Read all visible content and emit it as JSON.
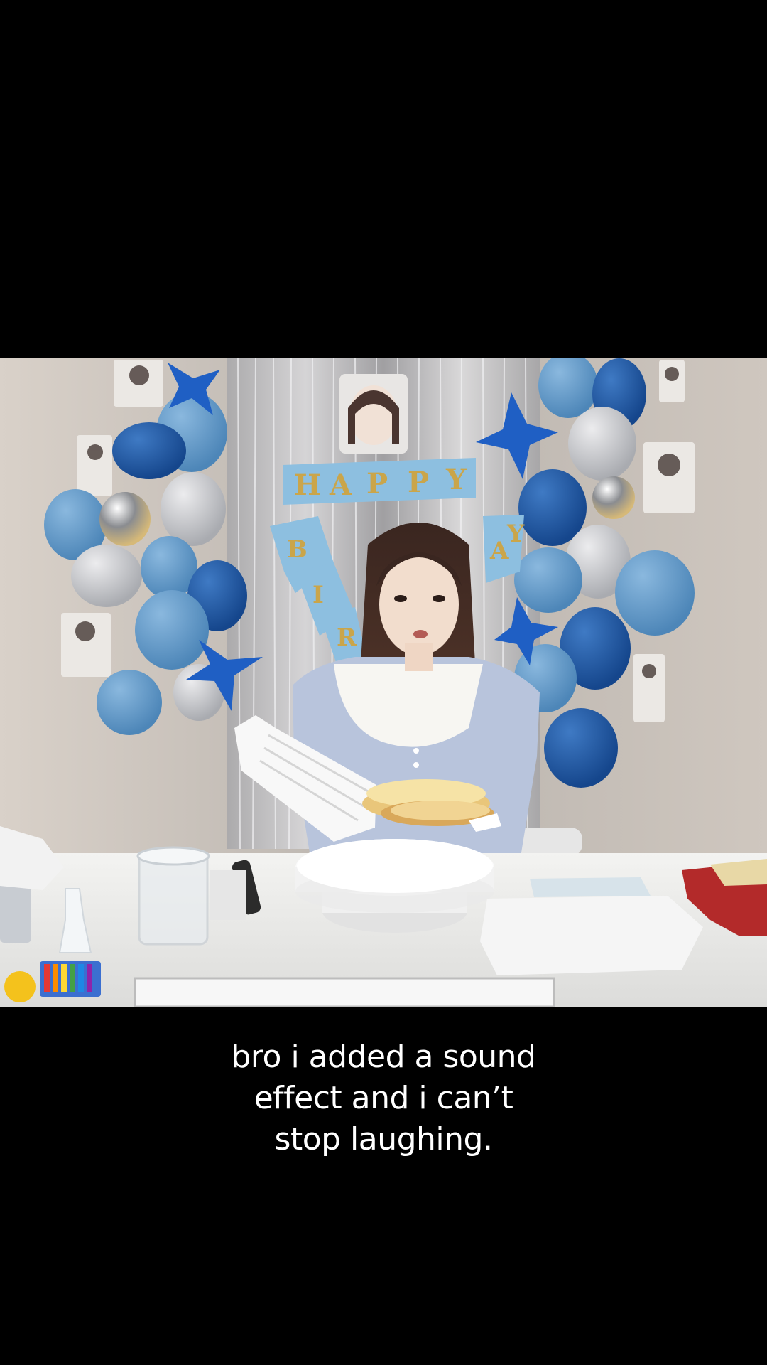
{
  "video": {
    "banner_top_letters": [
      "H",
      "A",
      "P",
      "P",
      "Y"
    ],
    "banner_left_letters": [
      "B",
      "I",
      "R"
    ],
    "banner_right_letters": [
      "A",
      "Y"
    ]
  },
  "caption": {
    "lines": [
      "bro i added a sound",
      "effect and i can’t",
      "stop laughing."
    ]
  },
  "colors": {
    "background": "#000000",
    "caption_text": "#ffffff",
    "balloon_light_blue": "#5f95c4",
    "balloon_dark_blue": "#1d56a6",
    "banner_blue": "#86b9dc",
    "banner_gold": "#caa54a"
  }
}
